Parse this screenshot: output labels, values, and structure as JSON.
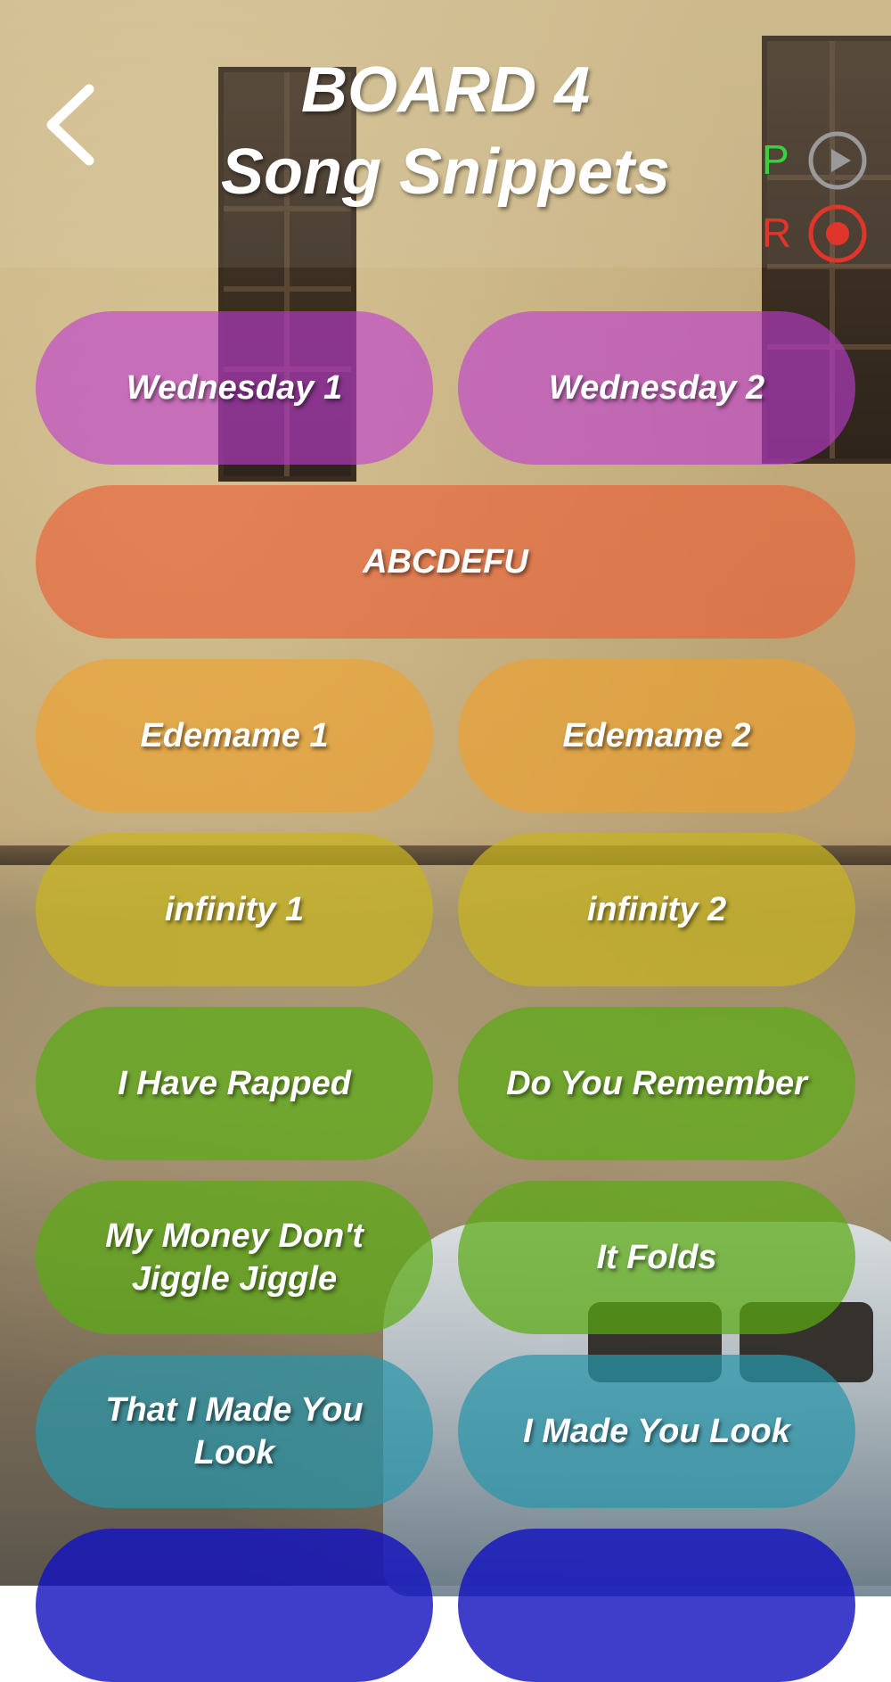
{
  "header": {
    "board_label": "BOARD 4",
    "board_name": "Song Snippets",
    "back_icon": "chevron-left-icon",
    "play_letter": "P",
    "record_letter": "R",
    "colors": {
      "play_letter": "#3ecf3e",
      "play_icon": "#9a9a9a",
      "record": "#e0352a"
    }
  },
  "buttons": [
    {
      "label": "Wednesday 1",
      "color": "purple"
    },
    {
      "label": "Wednesday 2",
      "color": "purple"
    },
    {
      "label": "ABCDEFU",
      "color": "red"
    },
    {
      "label": "Edemame 1",
      "color": "orange"
    },
    {
      "label": "Edemame 2",
      "color": "orange"
    },
    {
      "label": "infinity 1",
      "color": "yellow"
    },
    {
      "label": "infinity 2",
      "color": "yellow"
    },
    {
      "label": "I Have Rapped",
      "color": "green"
    },
    {
      "label": "Do You Remember",
      "color": "green"
    },
    {
      "label": "My Money Don't Jiggle Jiggle",
      "color": "green"
    },
    {
      "label": "It Folds",
      "color": "green"
    },
    {
      "label": "That I Made You Look",
      "color": "teal"
    },
    {
      "label": "I Made You Look",
      "color": "teal"
    },
    {
      "label": "",
      "color": "blue"
    },
    {
      "label": "",
      "color": "blue"
    }
  ]
}
